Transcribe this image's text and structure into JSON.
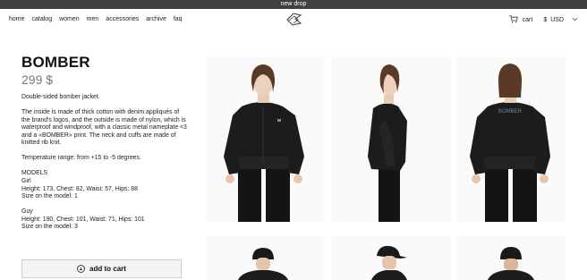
{
  "banner": {
    "text": "new drop"
  },
  "nav": {
    "items": [
      "home",
      "catalog",
      "women",
      "men",
      "accessories",
      "archive",
      "faq"
    ]
  },
  "header": {
    "cart_label": "cart",
    "currency": "USD"
  },
  "product": {
    "title": "BOMBER",
    "price": "299 $",
    "subtitle": "Double-sided bomber jacket.",
    "description": "The inside is made of thick cotton with denim appliqués of the brand's logos, and the outside is made of nylon, which is waterproof and windproof, with a classic metal nameplate <3 and a «BOMBER» print. The neck and cuffs are made of knitted rib knit.",
    "temperature": "Temperature range: from +15 to -5 degrees.",
    "models_heading": "MODELS",
    "models": [
      {
        "name": "Girl",
        "measurements": "Height: 173, Chest: 82, Waist: 57, Hips: 88",
        "size": "Size on the model: 1"
      },
      {
        "name": "Guy",
        "measurements": "Height: 190, Chest: 101, Waist: 71, Hips: 101",
        "size": "Size on the model: 3"
      }
    ],
    "add_to_cart": "add to cart",
    "jacket_print": "BOMBER"
  },
  "colors": {
    "banner_bg": "#3f3f3f",
    "jacket": "#1c1c1e",
    "hair": "#5a3a26",
    "photo_bg": "#fafafa",
    "print": "#6f8a99"
  },
  "icons": [
    "cart-icon",
    "chevron-down-icon",
    "logo-icon",
    "plus-circle-icon"
  ]
}
